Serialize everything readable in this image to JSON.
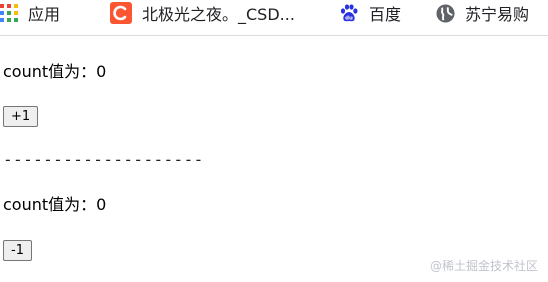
{
  "bookmarks": [
    {
      "label": "应用",
      "icon": "apps-grid-icon"
    },
    {
      "label": "北极光之夜。_CSD...",
      "icon": "csdn-icon"
    },
    {
      "label": "百度",
      "icon": "baidu-paw-icon"
    },
    {
      "label": "苏宁易购",
      "icon": "globe-icon"
    }
  ],
  "colors": {
    "csdn": "#fc5531",
    "baidu": "#2932e1",
    "apps_colors": [
      "#ea4335",
      "#fbbc05",
      "#34a853",
      "#4285f4"
    ],
    "globe": "#5f6368"
  },
  "counter_a": {
    "label": "count值为：0",
    "button": "+1"
  },
  "separator": "--------------------",
  "counter_b": {
    "label": "count值为：0",
    "button": "-1"
  },
  "watermark": "@稀土掘金技术社区"
}
